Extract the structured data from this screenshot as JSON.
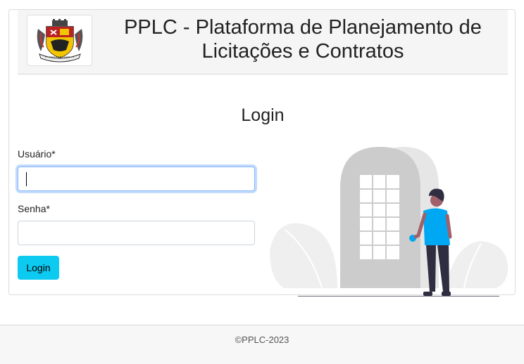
{
  "header": {
    "title": "PPLC - Plataforma de Planejamento de Licitações e Contratos",
    "logo": "municipal-coat-of-arms"
  },
  "login": {
    "heading": "Login",
    "username_label": "Usuário*",
    "username_value": "",
    "password_label": "Senha*",
    "password_value": "",
    "button_label": "Login"
  },
  "illustration": "person-at-door",
  "footer": {
    "text": "©PPLC-2023"
  },
  "colors": {
    "button": "#0dcaf0",
    "shirt": "#00a8f3",
    "door": "#cccccc",
    "header_bg": "#f5f5f5"
  }
}
